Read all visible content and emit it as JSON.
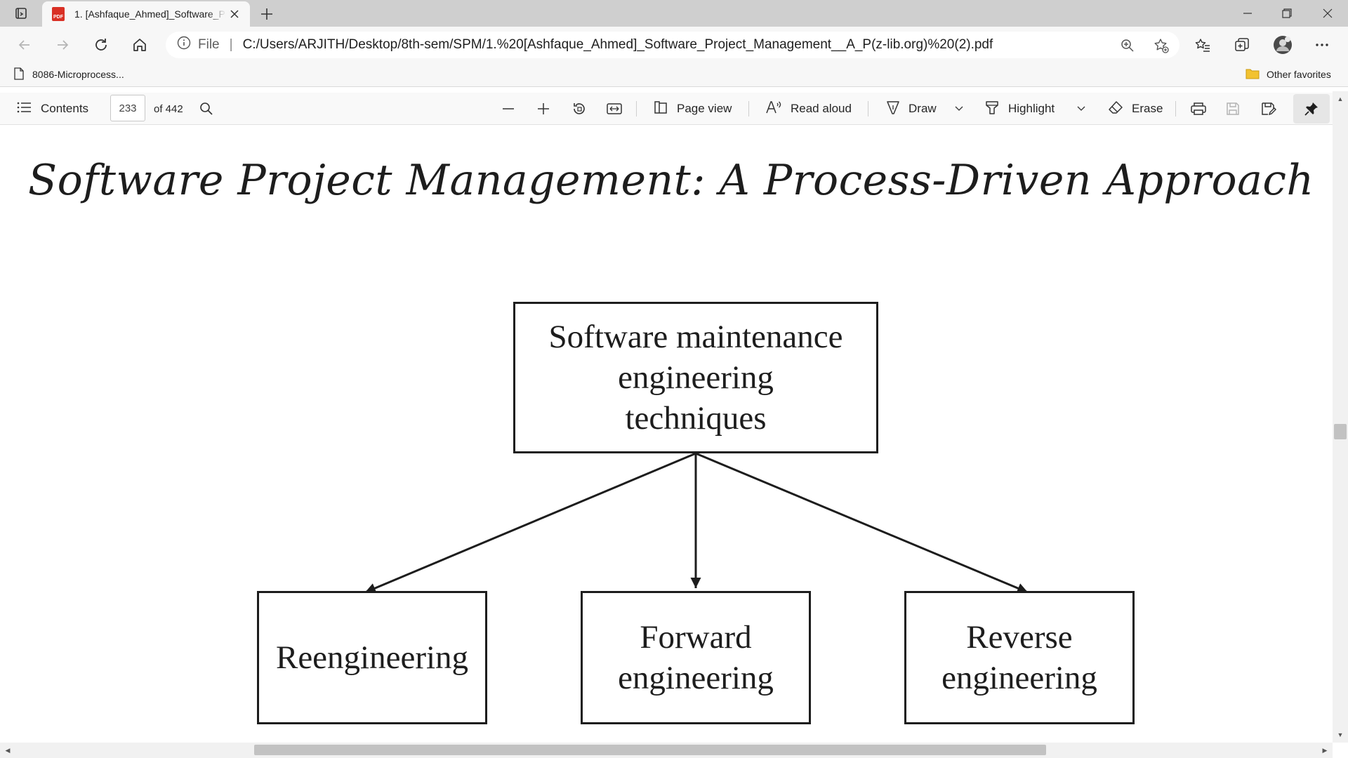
{
  "browser": {
    "tab": {
      "title": "1. [Ashfaque_Ahmed]_Software_Project_Management__A_P(z-lib.org) (2).pdf",
      "icon": "pdf-file-icon"
    },
    "address_bar": {
      "security_label": "File",
      "url": "C:/Users/ARJITH/Desktop/8th-sem/SPM/1.%20[Ashfaque_Ahmed]_Software_Project_Management__A_P(z-lib.org)%20(2).pdf"
    },
    "favorites": {
      "items": [
        {
          "label": "8086-Microprocess..."
        }
      ],
      "other_favorites": "Other favorites"
    }
  },
  "pdf_toolbar": {
    "contents_label": "Contents",
    "current_page": "233",
    "page_total": "of 442",
    "page_view_label": "Page view",
    "read_aloud_label": "Read aloud",
    "draw_label": "Draw",
    "highlight_label": "Highlight",
    "erase_label": "Erase"
  },
  "document": {
    "running_title": "Software Project Management: A Process-Driven Approach",
    "diagram": {
      "root": "Software maintenance\nengineering\ntechniques",
      "children": [
        "Reengineering",
        "Forward\nengineering",
        "Reverse\nengineering"
      ]
    }
  },
  "colors": {
    "tab_strip": "#cfcfcf",
    "toolbar": "#f7f7f7",
    "pdf_accent": "#d93025",
    "diagram_ink": "#1d1d1d"
  }
}
